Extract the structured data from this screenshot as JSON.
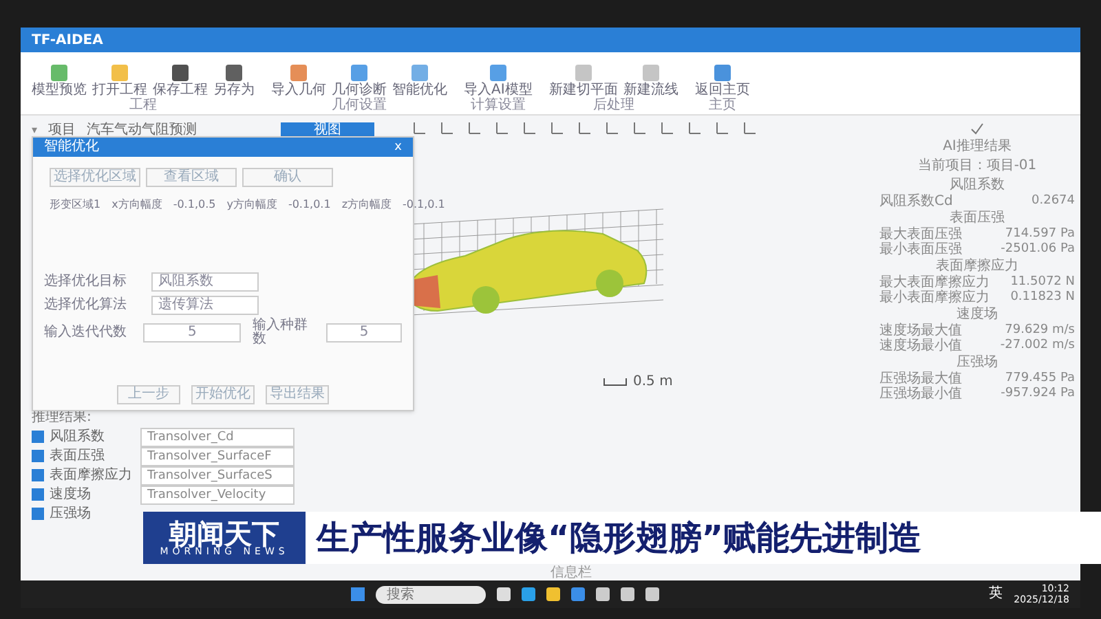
{
  "window": {
    "title": "TF-AIDEA"
  },
  "ribbon": {
    "groups": [
      {
        "label": "工程",
        "tools": [
          {
            "kind": "preview",
            "label": "模型预览"
          },
          {
            "kind": "folder",
            "label": "打开工程"
          },
          {
            "kind": "save",
            "label": "保存工程"
          },
          {
            "kind": "saveas",
            "label": "另存为"
          }
        ]
      },
      {
        "label": "几何设置",
        "tools": [
          {
            "kind": "import",
            "label": "导入几何"
          },
          {
            "kind": "diagnose",
            "label": "几何诊断"
          },
          {
            "kind": "optimize",
            "label": "智能优化"
          }
        ]
      },
      {
        "label": "计算设置",
        "tools": [
          {
            "kind": "model",
            "label": "导入AI模型"
          }
        ]
      },
      {
        "label": "后处理",
        "tools": [
          {
            "kind": "plane",
            "label": "新建切平面"
          },
          {
            "kind": "stream",
            "label": "新建流线"
          }
        ]
      },
      {
        "label": "主页",
        "tools": [
          {
            "kind": "home",
            "label": "返回主页"
          }
        ]
      }
    ],
    "tab": {
      "label": "视图",
      "selected": true
    }
  },
  "tree": {
    "toggle": "▾",
    "label": "项目",
    "value": "汽车气动气阻预测",
    "expanded": true
  },
  "dialog": {
    "title": "智能优化",
    "close": "x",
    "top_buttons": [
      "选择优化区域",
      "查看区域",
      "确认"
    ],
    "region": [
      "形变区域1",
      "x方向幅度",
      "-0.1,0.5",
      "y方向幅度",
      "-0.1,0.1",
      "z方向幅度",
      "-0.1,0.1"
    ],
    "target": {
      "label": "选择优化目标",
      "value": "风阻系数"
    },
    "algorithm": {
      "label": "选择优化算法",
      "value": "遗传算法"
    },
    "generations": {
      "label": "输入迭代代数",
      "value": "5"
    },
    "population": {
      "label": "输入种群数",
      "value": "5"
    },
    "bottom_buttons": [
      "上一步",
      "开始优化",
      "导出结果"
    ]
  },
  "viewer": {
    "scale": "0.5 m"
  },
  "results": {
    "title": "推理结果:",
    "items": [
      {
        "label": "风阻系数",
        "checked": true,
        "model": "Transolver_Cd"
      },
      {
        "label": "表面压强",
        "checked": true,
        "model": "Transolver_SurfaceF"
      },
      {
        "label": "表面摩擦应力",
        "checked": true,
        "model": "Transolver_SurfaceS"
      },
      {
        "label": "速度场",
        "checked": true,
        "model": "Transolver_Velocity"
      },
      {
        "label": "压强场",
        "checked": true
      }
    ]
  },
  "ai_panel": {
    "title": "AI推理结果",
    "project": "当前项目：项目-01",
    "sections": [
      {
        "title": "风阻系数",
        "rows": [
          {
            "label": "风阻系数Cd",
            "value": "0.2674"
          }
        ]
      },
      {
        "title": "表面压强",
        "rows": [
          {
            "label": "最大表面压强",
            "value": "714.597 Pa"
          },
          {
            "label": "最小表面压强",
            "value": "-2501.06 Pa"
          }
        ]
      },
      {
        "title": "表面摩擦应力",
        "rows": [
          {
            "label": "最大表面摩擦应力",
            "value": "11.5072 N"
          },
          {
            "label": "最小表面摩擦应力",
            "value": "0.11823 N"
          }
        ]
      },
      {
        "title": "速度场",
        "rows": [
          {
            "label": "速度场最大值",
            "value": "79.629 m/s"
          },
          {
            "label": "速度场最小值",
            "value": "-27.002 m/s"
          }
        ]
      },
      {
        "title": "压强场",
        "rows": [
          {
            "label": "压强场最大值",
            "value": "779.455 Pa"
          },
          {
            "label": "压强场最小值",
            "value": "-957.924 Pa"
          }
        ]
      }
    ]
  },
  "status_bar": {
    "label": "信息栏"
  },
  "taskbar": {
    "search": {
      "placeholder": "搜索"
    },
    "ime": "英",
    "time": "10:12",
    "date": "2025/12/18"
  },
  "news_banner": {
    "program": "朝闻天下",
    "program_en": "MORNING NEWS",
    "headline": "生产性服务业像“隐形翅膀”赋能先进制造"
  }
}
